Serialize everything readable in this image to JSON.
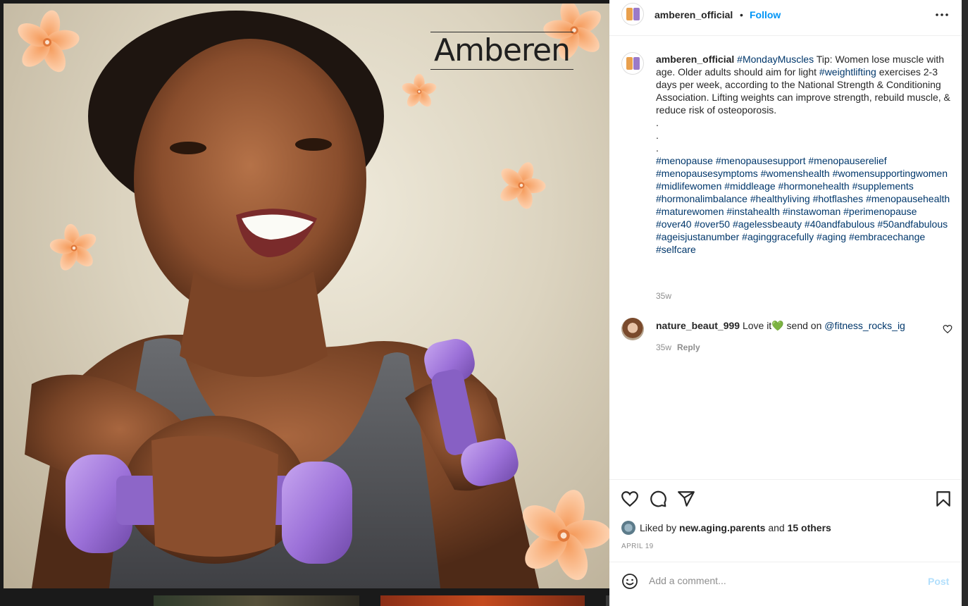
{
  "post": {
    "image_brand": "Amberen",
    "author": "amberen_official",
    "follow_label": "Follow",
    "more_icon": "more-horizontal-icon",
    "caption": {
      "username": "amberen_official",
      "lead_tag": "#MondayMuscles",
      "text_1": " Tip: Women lose muscle with age. Older adults should aim for light ",
      "tag_2": "#weightlifting",
      "text_2": " exercises 2-3 days per week, according to the National Strength & Conditioning Association. Lifting weights can improve strength, rebuild muscle, & reduce risk of osteoporosis.",
      "dots": [
        ".",
        ".",
        "."
      ],
      "hashtags": "#menopause #menopausesupport #menopauserelief #menopausesymptoms #womenshealth #womensupportingwomen #midlifewomen #middleage #hormonehealth #supplements #hormonalimbalance #healthyliving #hotflashes #menopausehealth #maturewomen #instahealth #instawoman #perimenopause #over40 #over50 #agelessbeauty #40andfabulous #50andfabulous #ageisjustanumber #aginggracefully #aging #embracechange #selfcare",
      "time": "35w"
    },
    "comments": [
      {
        "username": "nature_beaut_999",
        "text_before": " Love it",
        "emoji": "💚",
        "text_after": " send on ",
        "mention": "@fitness_rocks_ig",
        "time": "35w",
        "reply_label": "Reply"
      }
    ],
    "likes": {
      "prefix": "Liked by ",
      "user": "new.aging.parents",
      "middle": " and ",
      "others": "15 others"
    },
    "date": "APRIL 19",
    "add_comment": {
      "placeholder": "Add a comment...",
      "post_label": "Post"
    }
  },
  "colors": {
    "link_blue": "#0095f6",
    "hashtag": "#00376b",
    "post_disabled": "#b2dffc",
    "muted": "#8e8e8e"
  },
  "icons": [
    "heart-icon",
    "comment-icon",
    "share-icon",
    "bookmark-icon",
    "emoji-icon",
    "small-heart-icon"
  ]
}
